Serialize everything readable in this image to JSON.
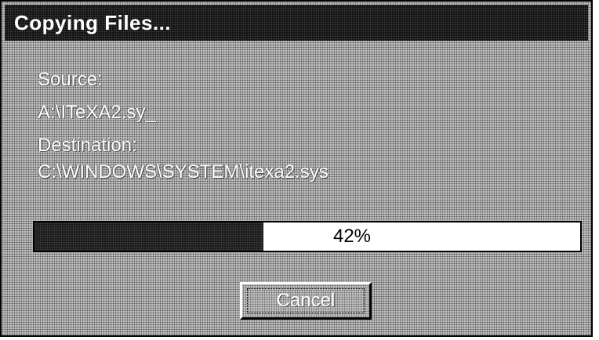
{
  "window": {
    "title": "Copying Files..."
  },
  "copy": {
    "source_label": "Source:",
    "source_value": "A:\\ITeXA2.sy_",
    "destination_label": "Destination:",
    "destination_value": "C:\\WINDOWS\\SYSTEM\\itexa2.sys"
  },
  "progress": {
    "percent": 42,
    "label": "42%"
  },
  "buttons": {
    "cancel_label": "Cancel"
  },
  "colors": {
    "dialog_face": "#c4c4c4",
    "titlebar": "#111111",
    "progress_fill": "#1a1a1a",
    "progress_track": "#ffffff"
  }
}
